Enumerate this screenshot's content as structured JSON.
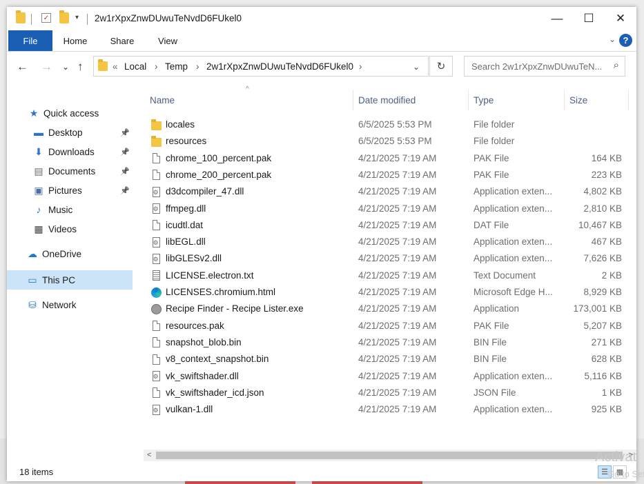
{
  "window": {
    "title": "2w1rXpxZnwDUwuTeNvdD6FUkel0",
    "controls": {
      "minimize": "—",
      "maximize": "☐",
      "close": "✕"
    }
  },
  "ribbon": {
    "tabs": [
      "File",
      "Home",
      "Share",
      "View"
    ],
    "expand_icon": "⌄",
    "help": "?"
  },
  "nav": {
    "back": "←",
    "forward": "→",
    "recent": "⌄",
    "up": "↑",
    "breadcrumb": [
      "Local",
      "Temp",
      "2w1rXpxZnwDUwuTeNvdD6FUkel0"
    ],
    "overflow": "«",
    "separator": "›",
    "dropdown": "⌄",
    "refresh": "↻",
    "search_placeholder": "Search 2w1rXpxZnwDUwuTeN...",
    "search_icon": "⌕"
  },
  "sidebar": {
    "items": [
      {
        "label": "Quick access",
        "icon": "star-icon",
        "glyph": "★",
        "color": "#2f73c9"
      },
      {
        "label": "Desktop",
        "icon": "desktop-icon",
        "glyph": "▬",
        "color": "#2f73c9",
        "pinned": true
      },
      {
        "label": "Downloads",
        "icon": "download-icon",
        "glyph": "⬇",
        "color": "#2f73c9",
        "pinned": true
      },
      {
        "label": "Documents",
        "icon": "document-icon",
        "glyph": "▤",
        "color": "#6d6d6d",
        "pinned": true
      },
      {
        "label": "Pictures",
        "icon": "picture-icon",
        "glyph": "▣",
        "color": "#4a6fa5",
        "pinned": true
      },
      {
        "label": "Music",
        "icon": "music-icon",
        "glyph": "♪",
        "color": "#2f73c9"
      },
      {
        "label": "Videos",
        "icon": "video-icon",
        "glyph": "▦",
        "color": "#444444"
      },
      {
        "label": "OneDrive",
        "icon": "cloud-icon",
        "glyph": "☁",
        "color": "#1f78d1"
      },
      {
        "label": "This PC",
        "icon": "computer-icon",
        "glyph": "▭",
        "color": "#2f73c9",
        "selected": true
      },
      {
        "label": "Network",
        "icon": "network-icon",
        "glyph": "⛁",
        "color": "#2f73c9"
      }
    ],
    "pin_glyph": "📌"
  },
  "columns": {
    "name": "Name",
    "date": "Date modified",
    "type": "Type",
    "size": "Size",
    "sort_arrow": "^"
  },
  "files": [
    {
      "name": "locales",
      "date": "6/5/2025 5:53 PM",
      "type": "File folder",
      "size": "",
      "icon": "folder"
    },
    {
      "name": "resources",
      "date": "6/5/2025 5:53 PM",
      "type": "File folder",
      "size": "",
      "icon": "folder"
    },
    {
      "name": "chrome_100_percent.pak",
      "date": "4/21/2025 7:19 AM",
      "type": "PAK File",
      "size": "164 KB",
      "icon": "file"
    },
    {
      "name": "chrome_200_percent.pak",
      "date": "4/21/2025 7:19 AM",
      "type": "PAK File",
      "size": "223 KB",
      "icon": "file"
    },
    {
      "name": "d3dcompiler_47.dll",
      "date": "4/21/2025 7:19 AM",
      "type": "Application exten...",
      "size": "4,802 KB",
      "icon": "dll"
    },
    {
      "name": "ffmpeg.dll",
      "date": "4/21/2025 7:19 AM",
      "type": "Application exten...",
      "size": "2,810 KB",
      "icon": "dll"
    },
    {
      "name": "icudtl.dat",
      "date": "4/21/2025 7:19 AM",
      "type": "DAT File",
      "size": "10,467 KB",
      "icon": "file"
    },
    {
      "name": "libEGL.dll",
      "date": "4/21/2025 7:19 AM",
      "type": "Application exten...",
      "size": "467 KB",
      "icon": "dll"
    },
    {
      "name": "libGLESv2.dll",
      "date": "4/21/2025 7:19 AM",
      "type": "Application exten...",
      "size": "7,626 KB",
      "icon": "dll"
    },
    {
      "name": "LICENSE.electron.txt",
      "date": "4/21/2025 7:19 AM",
      "type": "Text Document",
      "size": "2 KB",
      "icon": "txt"
    },
    {
      "name": "LICENSES.chromium.html",
      "date": "4/21/2025 7:19 AM",
      "type": "Microsoft Edge H...",
      "size": "8,929 KB",
      "icon": "edge"
    },
    {
      "name": "Recipe Finder - Recipe Lister.exe",
      "date": "4/21/2025 7:19 AM",
      "type": "Application",
      "size": "173,001 KB",
      "icon": "exe"
    },
    {
      "name": "resources.pak",
      "date": "4/21/2025 7:19 AM",
      "type": "PAK File",
      "size": "5,207 KB",
      "icon": "file"
    },
    {
      "name": "snapshot_blob.bin",
      "date": "4/21/2025 7:19 AM",
      "type": "BIN File",
      "size": "271 KB",
      "icon": "file"
    },
    {
      "name": "v8_context_snapshot.bin",
      "date": "4/21/2025 7:19 AM",
      "type": "BIN File",
      "size": "628 KB",
      "icon": "file"
    },
    {
      "name": "vk_swiftshader.dll",
      "date": "4/21/2025 7:19 AM",
      "type": "Application exten...",
      "size": "5,116 KB",
      "icon": "dll"
    },
    {
      "name": "vk_swiftshader_icd.json",
      "date": "4/21/2025 7:19 AM",
      "type": "JSON File",
      "size": "1 KB",
      "icon": "file"
    },
    {
      "name": "vulkan-1.dll",
      "date": "4/21/2025 7:19 AM",
      "type": "Application exten...",
      "size": "925 KB",
      "icon": "dll"
    }
  ],
  "scrollbar": {
    "left": "<",
    "right": ">"
  },
  "status": {
    "count": "18 items",
    "details_view": "☰",
    "large_icons_view": "▦"
  },
  "watermark": {
    "line1": "Activat",
    "line2": "Go to Set"
  },
  "colors": {
    "accent": "#1a5fb4",
    "selection": "#cce4f7",
    "folder": "#f4c542"
  }
}
